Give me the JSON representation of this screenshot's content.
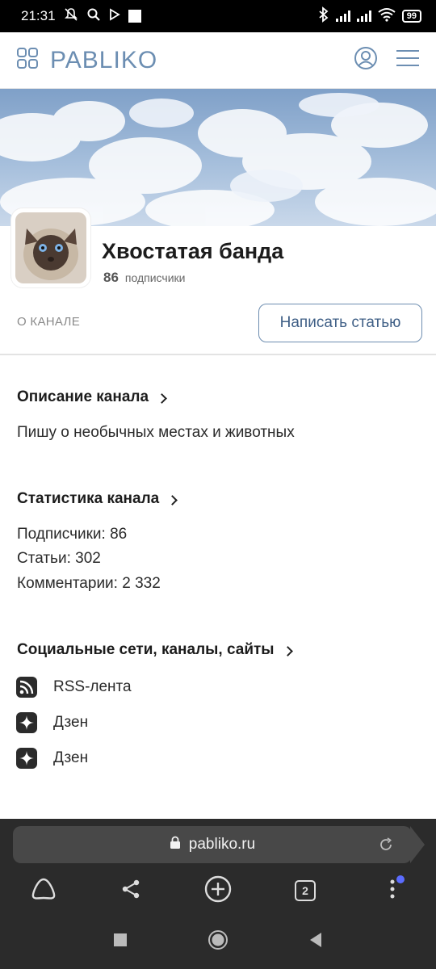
{
  "status_bar": {
    "time": "21:31",
    "battery": "99"
  },
  "header": {
    "logo_text": "PABLIKO",
    "icons": [
      "grid-logo-icon",
      "user-icon",
      "menu-icon"
    ]
  },
  "channel": {
    "title": "Хвостатая банда",
    "subscribers_count": "86",
    "subscribers_label": "подписчики",
    "about_label": "О КАНАЛЕ",
    "write_button": "Написать статью"
  },
  "description": {
    "title": "Описание канала",
    "text": "Пишу о необычных местах и животных"
  },
  "stats": {
    "title": "Статистика канала",
    "subscribers": "Подписчики: 86",
    "articles": "Статьи: 302",
    "comments": "Комментарии: 2 332"
  },
  "social": {
    "title": "Социальные сети, каналы, сайты",
    "items": [
      {
        "label": "RSS-лента",
        "icon": "rss-icon"
      },
      {
        "label": "Дзен",
        "icon": "dzen-icon"
      },
      {
        "label": "Дзен",
        "icon": "dzen-icon"
      }
    ]
  },
  "browser": {
    "url": "pabliko.ru",
    "tabs_count": "2"
  },
  "colors": {
    "brand": "#6c8eb2",
    "button_border": "#6d8db0",
    "browser_bg": "#2b2b2b"
  }
}
